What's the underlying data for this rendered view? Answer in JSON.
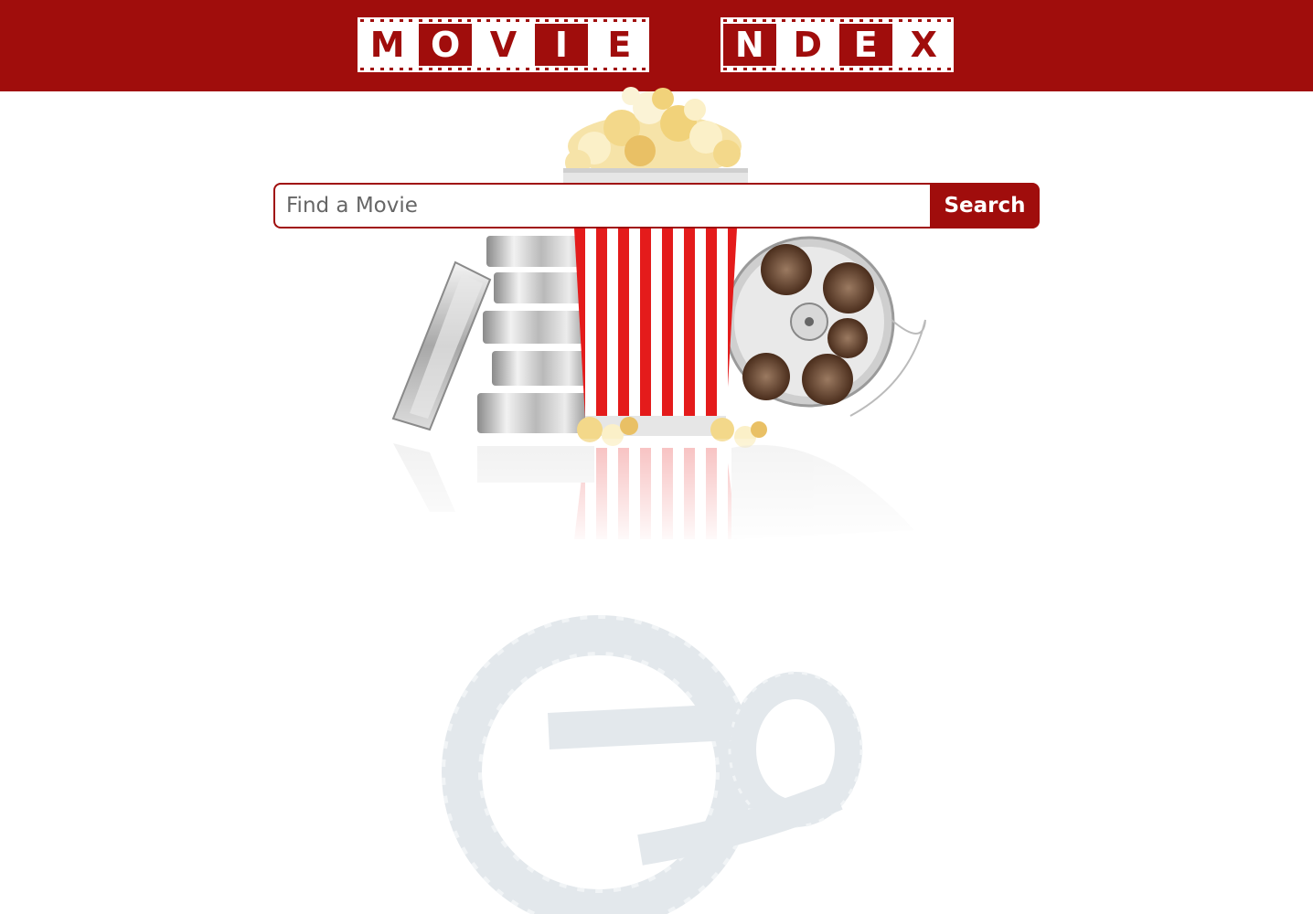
{
  "header": {
    "logo_word_1": [
      "M",
      "O",
      "V",
      "I",
      "E"
    ],
    "logo_word_2": [
      "N",
      "D",
      "E",
      "X"
    ],
    "brand_color": "#a00d0c"
  },
  "search": {
    "placeholder": "Find a Movie",
    "value": "",
    "button_label": "Search"
  },
  "illustration": {
    "items": [
      "film-canisters",
      "popcorn-bucket",
      "film-reel",
      "film-strip"
    ]
  }
}
